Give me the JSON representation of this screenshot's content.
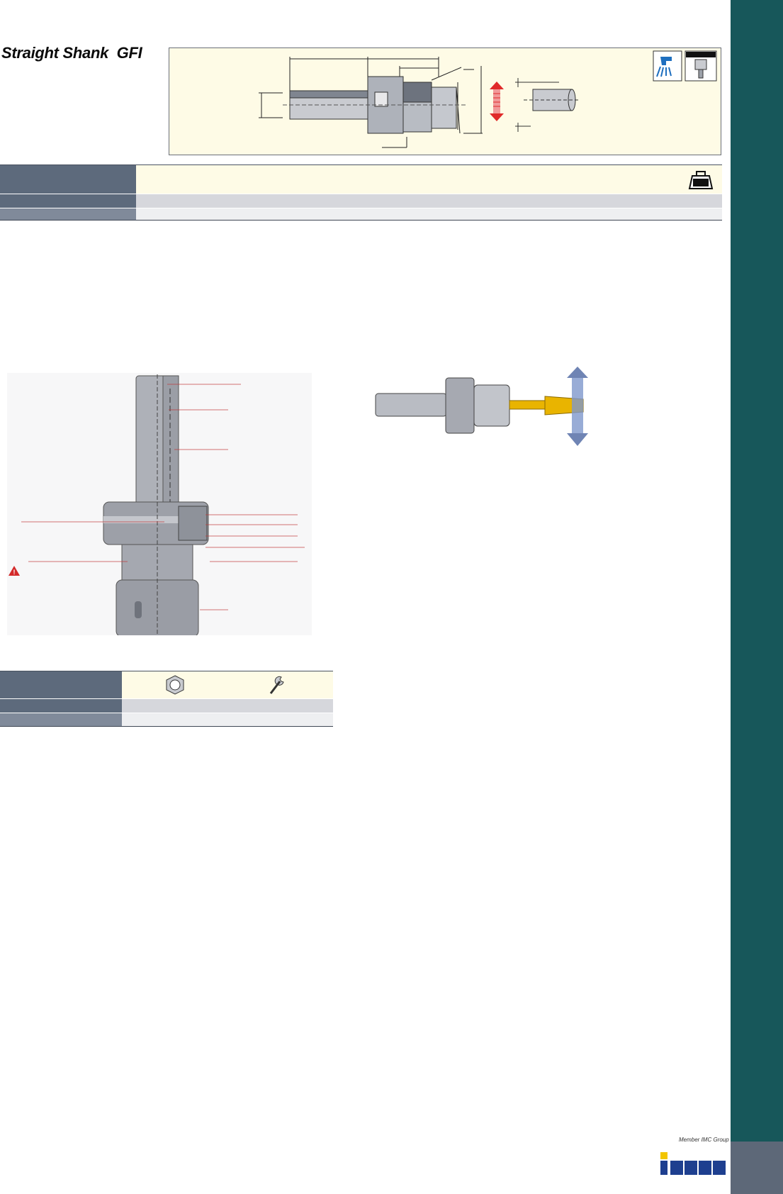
{
  "page": {
    "title": "Straight Shank  GFI"
  },
  "brand": {
    "logo_text": "iscar",
    "tagline": "Member IMC Group"
  },
  "colors": {
    "side_tab": "#17575a",
    "side_tab_bottom": "#5d6878",
    "table_label": "#5d6a7c",
    "table_label_light": "#808a9a",
    "table_header_bg": "#fefbe6",
    "logo_blue": "#1e3f8f",
    "logo_yellow": "#f2c500",
    "warning_red": "#d32a2a",
    "drill_yellow": "#e9b400"
  },
  "icons": {
    "coolant": "coolant-faucet-icon",
    "setup": "machine-setup-icon",
    "weight": "weight-icon",
    "nut": "clamping-nut-icon",
    "wrench": "wrench-icon",
    "float": "radial-float-arrow-icon",
    "warning": "warning-icon"
  }
}
